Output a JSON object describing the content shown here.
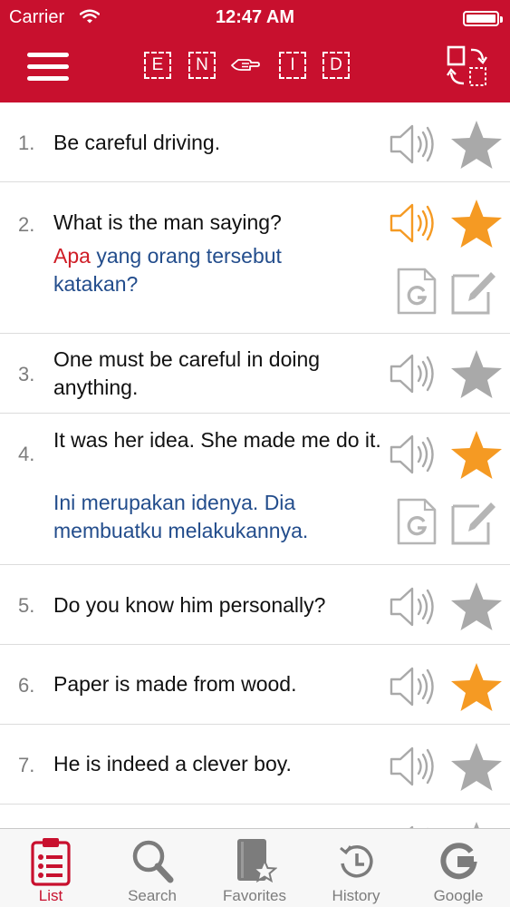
{
  "status_bar": {
    "carrier": "Carrier",
    "time": "12:47 AM"
  },
  "header": {
    "languages": [
      "E",
      "N",
      "I",
      "D"
    ],
    "icons": [
      "menu-icon",
      "swap-hand-icon",
      "swap-page-icon"
    ]
  },
  "phrases": [
    {
      "number": "1.",
      "english": "Be careful driving.",
      "translation_highlight": "",
      "translation": "",
      "favorite": false,
      "playing": false
    },
    {
      "number": "2.",
      "english": "What is the man saying?",
      "translation_highlight": "Apa",
      "translation": " yang orang tersebut katakan?",
      "favorite": true,
      "playing": true
    },
    {
      "number": "3.",
      "english": "One must be careful in doing anything.",
      "translation_highlight": "",
      "translation": "",
      "favorite": false,
      "playing": false
    },
    {
      "number": "4.",
      "english": "It was her idea. She made me do it.",
      "translation_highlight": "",
      "translation": "Ini merupakan idenya. Dia membuatku melakukannya.",
      "favorite": true,
      "playing": false
    },
    {
      "number": "5.",
      "english": "Do you know him personally?",
      "translation_highlight": "",
      "translation": "",
      "favorite": false,
      "playing": false
    },
    {
      "number": "6.",
      "english": "Paper is made from wood.",
      "translation_highlight": "",
      "translation": "",
      "favorite": true,
      "playing": false
    },
    {
      "number": "7.",
      "english": "He is indeed a clever boy.",
      "translation_highlight": "",
      "translation": "",
      "favorite": false,
      "playing": false
    }
  ],
  "colors": {
    "header": "#c8102e",
    "translation": "#234d8c",
    "highlight": "#cf1d26",
    "active": "#f59a23",
    "inactive": "#a9a9a9"
  },
  "tabs": [
    {
      "label": "List",
      "icon": "clipboard-list-icon",
      "active": true
    },
    {
      "label": "Search",
      "icon": "magnifier-icon",
      "active": false
    },
    {
      "label": "Favorites",
      "icon": "favorites-book-icon",
      "active": false
    },
    {
      "label": "History",
      "icon": "history-clock-icon",
      "active": false
    },
    {
      "label": "Google",
      "icon": "google-icon",
      "active": false
    }
  ]
}
